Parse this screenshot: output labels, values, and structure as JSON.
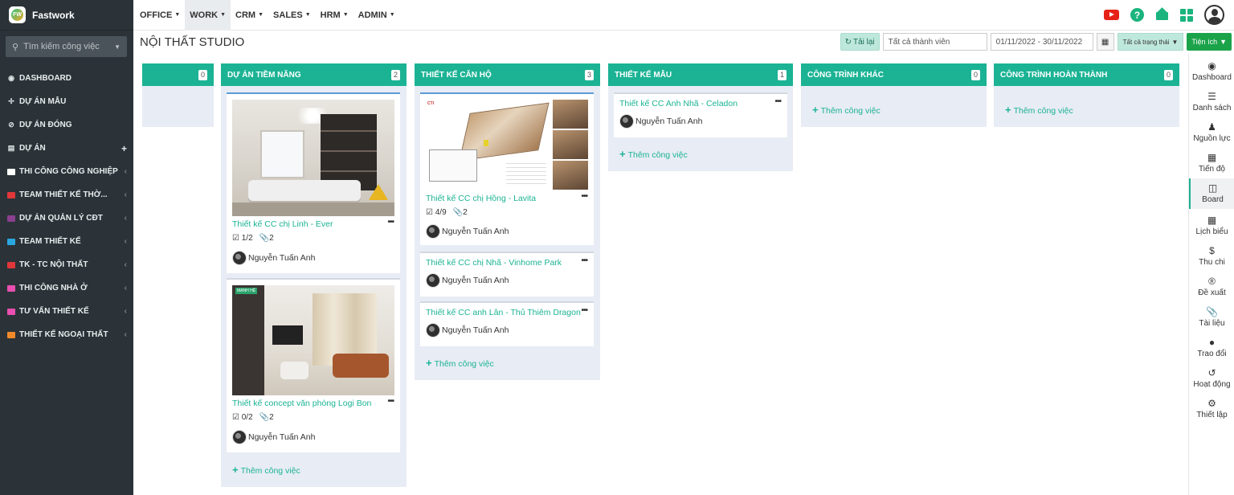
{
  "brand": {
    "name": "Fastwork",
    "logo_text": "FW"
  },
  "search": {
    "placeholder": "Tìm kiếm công việc"
  },
  "sidebar": {
    "items": [
      {
        "label": "DASHBOARD",
        "icon": "dashboard-icon"
      },
      {
        "label": "DỰ ÁN MẪU",
        "icon": "expand-icon"
      },
      {
        "label": "DỰ ÁN ĐÓNG",
        "icon": "ban-icon"
      },
      {
        "label": "DỰ ÁN",
        "icon": "folder-open-icon"
      },
      {
        "label": "THI CÔNG CÔNG NGHIỆP",
        "color": "#ffffff"
      },
      {
        "label": "TEAM THIẾT KẾ THỜ...",
        "color": "#e0373b"
      },
      {
        "label": "DỰ ÁN QUẢN LÝ CĐT",
        "color": "#8a3f8f"
      },
      {
        "label": "TEAM THIẾT KẾ",
        "color": "#2aa7e0"
      },
      {
        "label": "TK - TC NỘI THẤT",
        "color": "#e0373b"
      },
      {
        "label": "THI CÔNG NHÀ Ở",
        "color": "#e84fb0"
      },
      {
        "label": "TƯ VẤN THIẾT KẾ",
        "color": "#e84fb0"
      },
      {
        "label": "THIẾT KẾ NGOẠI THẤT",
        "color": "#f0892a"
      }
    ]
  },
  "topmenu": [
    "OFFICE",
    "WORK",
    "CRM",
    "SALES",
    "HRM",
    "ADMIN"
  ],
  "page": {
    "title": "NỘI THẤT STUDIO",
    "reload": "Tải lại",
    "members_placeholder": "Tất cả thành viên",
    "date_range": "01/11/2022 - 30/11/2022",
    "status": "Tất cả trạng thái",
    "utilities": "Tiện ích"
  },
  "board": {
    "add_task": "Thêm công việc",
    "columns": [
      {
        "title": "",
        "count": "0"
      },
      {
        "title": "DỰ ÁN TIỀM NĂNG",
        "count": "2"
      },
      {
        "title": "THIẾT KẾ CĂN HỘ",
        "count": "3"
      },
      {
        "title": "THIẾT KẾ MẪU",
        "count": "1"
      },
      {
        "title": "CÔNG TRÌNH KHÁC",
        "count": "0"
      },
      {
        "title": "CÔNG TRÌNH HOÀN THÀNH",
        "count": "0"
      }
    ],
    "cards": [
      {
        "title": "Thiết kế CC chị Linh - Ever",
        "checklist": "1/2",
        "attachments": "2",
        "user": "Nguyễn Tuấn Anh"
      },
      {
        "title": "Thiết kế concept văn phòng Logi Bon",
        "checklist": "0/2",
        "attachments": "2",
        "user": "Nguyễn Tuấn Anh"
      },
      {
        "title": "Thiết kế CC chị Hồng - Lavita",
        "checklist": "4/9",
        "attachments": "2",
        "user": "Nguyễn Tuấn Anh"
      },
      {
        "title": "Thiết kế CC chị Nhã - Vinhome Park",
        "user": "Nguyễn Tuấn Anh"
      },
      {
        "title": "Thiết kế CC anh Lân - Thủ Thiêm Dragon",
        "user": "Nguyễn Tuấn Anh"
      },
      {
        "title": "Thiết kế CC Anh Nhã - Celadon",
        "user": "Nguyễn Tuấn Anh"
      }
    ]
  },
  "rightpanel": [
    "Dashboard",
    "Danh sách",
    "Nguồn lực",
    "Tiến độ",
    "Board",
    "Lịch biểu",
    "Thu chi",
    "Đề xuất",
    "Tài liệu",
    "Trao đổi",
    "Hoạt động",
    "Thiết lập"
  ],
  "colors": {
    "accent": "#1bb394",
    "sidebar_bg": "#2b3338",
    "column_bg": "#e8ecf5",
    "util_button": "#1ba34a"
  }
}
